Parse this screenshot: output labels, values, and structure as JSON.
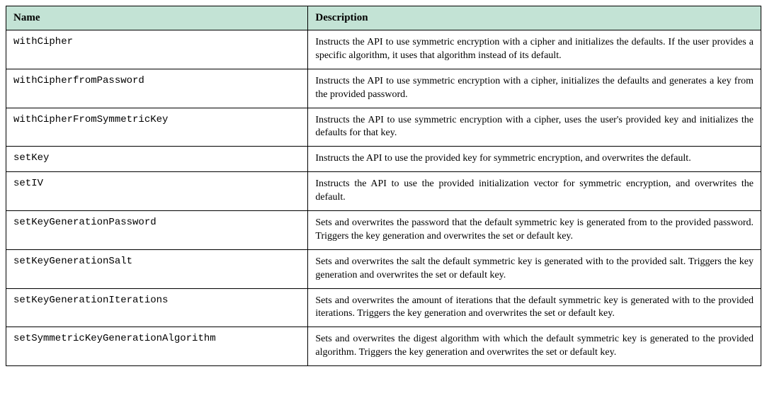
{
  "headers": {
    "name": "Name",
    "description": "Description"
  },
  "rows": [
    {
      "name": "withCipher",
      "description": "Instructs the API to use symmetric encryption with a cipher and initializes the defaults. If the user provides a specific algorithm, it uses that algorithm instead of its default."
    },
    {
      "name": "withCipherfromPassword",
      "description": "Instructs the API to use symmetric encryption with a cipher, initializes the defaults and generates a key from the provided password."
    },
    {
      "name": "withCipherFromSymmetricKey",
      "description": "Instructs the API to use symmetric encryption with a cipher, uses the user's provided key and initializes the defaults for that key."
    },
    {
      "name": "setKey",
      "description": "Instructs the API to use the provided key for symmetric encryption, and overwrites the default."
    },
    {
      "name": "setIV",
      "description": "Instructs the API to use the provided initialization vector for symmetric encryption, and overwrites the default."
    },
    {
      "name": "setKeyGenerationPassword",
      "description": "Sets and overwrites the password that the default symmetric key is generated from to the provided password. Triggers the key generation and overwrites the set or default key."
    },
    {
      "name": "setKeyGenerationSalt",
      "description": "Sets and overwrites the salt the default symmetric key is generated with to the provided salt. Triggers the key generation and overwrites the set or default key."
    },
    {
      "name": "setKeyGenerationIterations",
      "description": "Sets and overwrites the amount of iterations that the default symmetric key is generated with to the provided iterations. Triggers the key generation and overwrites the set or default key."
    },
    {
      "name": "setSymmetricKeyGenerationAlgorithm",
      "description": "Sets and overwrites the digest algorithm with which the default symmetric key is generated to the provided algorithm. Triggers the key generation and overwrites the set or default key."
    }
  ]
}
